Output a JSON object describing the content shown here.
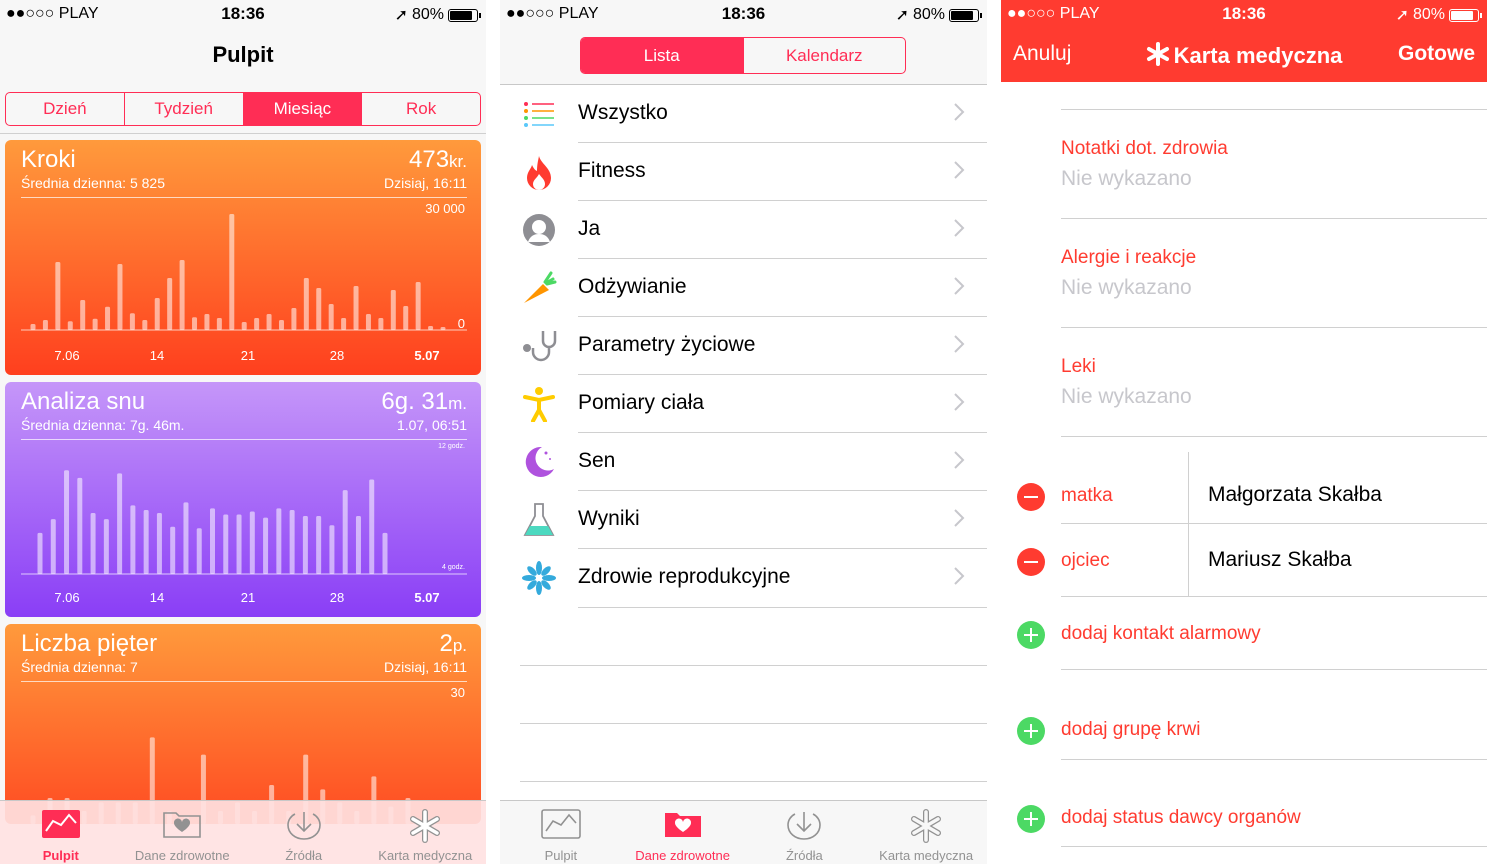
{
  "status": {
    "carrier": "●●○○○ PLAY",
    "time": "18:36",
    "battery": "80%"
  },
  "dashboard": {
    "title": "Pulpit",
    "segments": [
      {
        "label": "Dzień",
        "active": false
      },
      {
        "label": "Tydzień",
        "active": false
      },
      {
        "label": "Miesiąc",
        "active": true
      },
      {
        "label": "Rok",
        "active": false
      }
    ],
    "cards": [
      {
        "title": "Kroki",
        "subtitle": "Średnia dzienna: 5 825",
        "value": "473",
        "unit": "kr.",
        "when": "Dzisiaj, 16:11",
        "max_label": "30 000",
        "min_label": "0",
        "colors": [
          "#ff9a3c",
          "#ff3f1e"
        ],
        "ticks": [
          "7.06",
          "14",
          "21",
          "28",
          "5.07"
        ]
      },
      {
        "title": "Analiza snu",
        "subtitle": "Średnia dzienna: 7g. 46m.",
        "value": "6g. 31",
        "unit": "m.",
        "when": "1.07, 06:51",
        "max_label": "12 godz.",
        "min_label": "4 godz.",
        "colors": [
          "#c596f9",
          "#8a3ef6"
        ],
        "ticks": [
          "7.06",
          "14",
          "21",
          "28",
          "5.07"
        ]
      },
      {
        "title": "Liczba pięter",
        "subtitle": "Średnia dzienna: 7",
        "value": "2",
        "unit": "p.",
        "when": "Dzisiaj, 16:11",
        "max_label": "30",
        "min_label": "",
        "colors": [
          "#ff9a3c",
          "#ff4b22"
        ],
        "ticks": []
      }
    ]
  },
  "chart_data": [
    {
      "type": "bar",
      "title": "Kroki",
      "ylim": [
        0,
        30000
      ],
      "x": [
        "7.06",
        "14",
        "21",
        "28",
        "5.07"
      ],
      "values": [
        1500,
        2500,
        17000,
        2200,
        7500,
        2800,
        5800,
        16500,
        4200,
        2500,
        8000,
        13000,
        17500,
        3200,
        4000,
        3000,
        29000,
        2000,
        3000,
        4000,
        2500,
        5500,
        13000,
        10500,
        6500,
        3000,
        11000,
        4000,
        3000,
        10000,
        6000,
        12000,
        1000,
        300
      ]
    },
    {
      "type": "bar",
      "title": "Analiza snu",
      "ylim": [
        4,
        12
      ],
      "x": [
        "7.06",
        "14",
        "21",
        "28",
        "5.07"
      ],
      "values": [
        6.7,
        7.6,
        10.8,
        10.3,
        8.0,
        7.6,
        10.6,
        8.5,
        8.2,
        8.0,
        7.1,
        8.7,
        7.0,
        8.3,
        7.9,
        7.9,
        8.1,
        7.7,
        8.3,
        8.2,
        7.8,
        7.8,
        7.2,
        9.5,
        7.8,
        10.2,
        6.7
      ]
    },
    {
      "type": "bar",
      "title": "Liczba pięter",
      "ylim": [
        0,
        30
      ],
      "x": [],
      "values": [
        2,
        6,
        6,
        3,
        5,
        5,
        5,
        20,
        3,
        2,
        16,
        3,
        5,
        3,
        9,
        3,
        16,
        8,
        5,
        3,
        11,
        4,
        6,
        3
      ]
    }
  ],
  "health_data": {
    "seg": [
      {
        "label": "Lista",
        "active": true
      },
      {
        "label": "Kalendarz",
        "active": false
      }
    ],
    "rows": [
      {
        "label": "Wszystko",
        "icon": "list-icon"
      },
      {
        "label": "Fitness",
        "icon": "flame-icon"
      },
      {
        "label": "Ja",
        "icon": "person-icon"
      },
      {
        "label": "Odżywianie",
        "icon": "carrot-icon"
      },
      {
        "label": "Parametry życiowe",
        "icon": "stethoscope-icon"
      },
      {
        "label": "Pomiary ciała",
        "icon": "body-icon"
      },
      {
        "label": "Sen",
        "icon": "moon-icon"
      },
      {
        "label": "Wyniki",
        "icon": "flask-icon"
      },
      {
        "label": "Zdrowie reprodukcyjne",
        "icon": "snowflake-icon"
      }
    ]
  },
  "tabs": [
    {
      "label": "Pulpit",
      "icon": "dashboard-icon"
    },
    {
      "label": "Dane zdrowotne",
      "icon": "health-data-icon"
    },
    {
      "label": "Źródła",
      "icon": "sources-icon"
    },
    {
      "label": "Karta medyczna",
      "icon": "medical-id-icon"
    }
  ],
  "medical": {
    "cancel": "Anuluj",
    "title": "Karta medyczna",
    "done": "Gotowe",
    "fields": [
      {
        "label": "Notatki dot. zdrowia",
        "value": "Nie wykazano"
      },
      {
        "label": "Alergie i reakcje",
        "value": "Nie wykazano"
      },
      {
        "label": "Leki",
        "value": "Nie wykazano"
      }
    ],
    "contacts": [
      {
        "relation": "matka",
        "name": "Małgorzata Skałba"
      },
      {
        "relation": "ojciec",
        "name": "Mariusz Skałba"
      }
    ],
    "add_contact": "dodaj kontakt alarmowy",
    "add_blood": "dodaj grupę krwi",
    "add_donor": "dodaj status dawcy organów"
  },
  "colors": {
    "pink": "#ff2d55",
    "red": "#ff3b30",
    "green": "#4cd964",
    "gray": "#929292"
  }
}
